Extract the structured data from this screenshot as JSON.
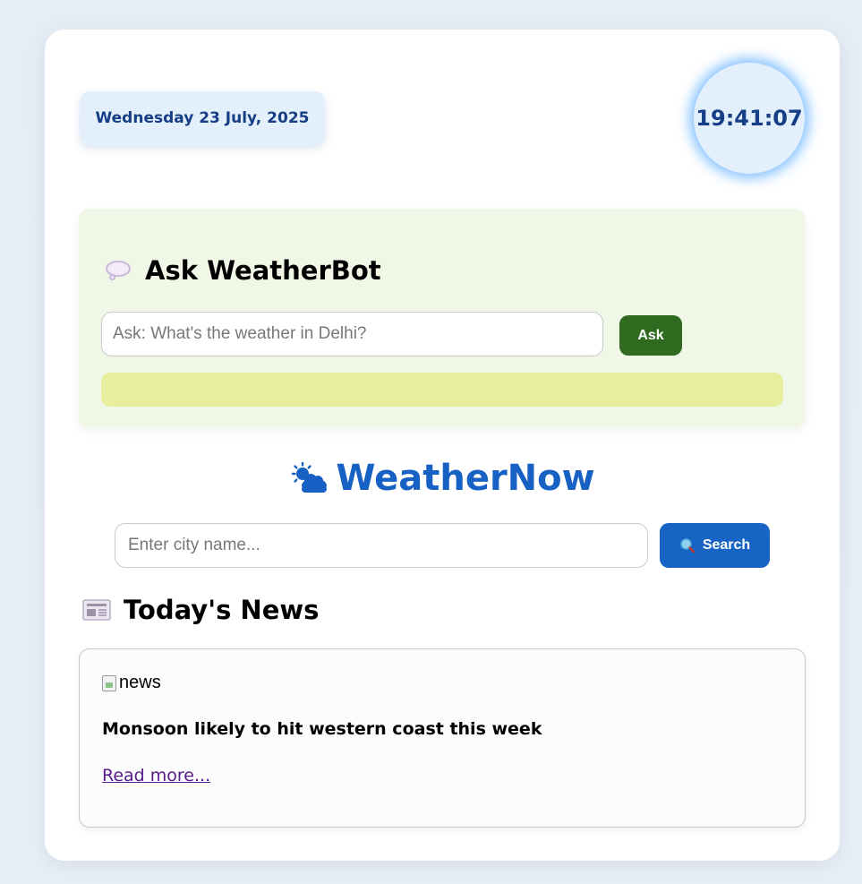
{
  "header": {
    "date": "Wednesday 23 July, 2025",
    "time": "19:41:07"
  },
  "weatherbot": {
    "icon": "speech-bubble-icon",
    "title": "Ask WeatherBot",
    "input_placeholder": "Ask: What's the weather in Delhi?",
    "input_value": "",
    "ask_label": "Ask",
    "response_text": ""
  },
  "brand": {
    "icon": "sun-behind-cloud-icon",
    "name": "WeatherNow"
  },
  "search": {
    "placeholder": "Enter city name...",
    "value": "",
    "button_icon": "magnifier-icon",
    "button_label": "Search"
  },
  "news": {
    "icon": "newspaper-icon",
    "heading": "Today's News",
    "items": [
      {
        "image_alt": "news",
        "title": "Monsoon likely to hit western coast this week",
        "link_text": "Read more..."
      }
    ]
  },
  "colors": {
    "brand_blue": "#1764c4",
    "ask_green": "#2f6a1f",
    "bot_panel_bg": "#f0f7e7",
    "bot_response_bg": "#e7ef9e",
    "date_text": "#163e86"
  }
}
